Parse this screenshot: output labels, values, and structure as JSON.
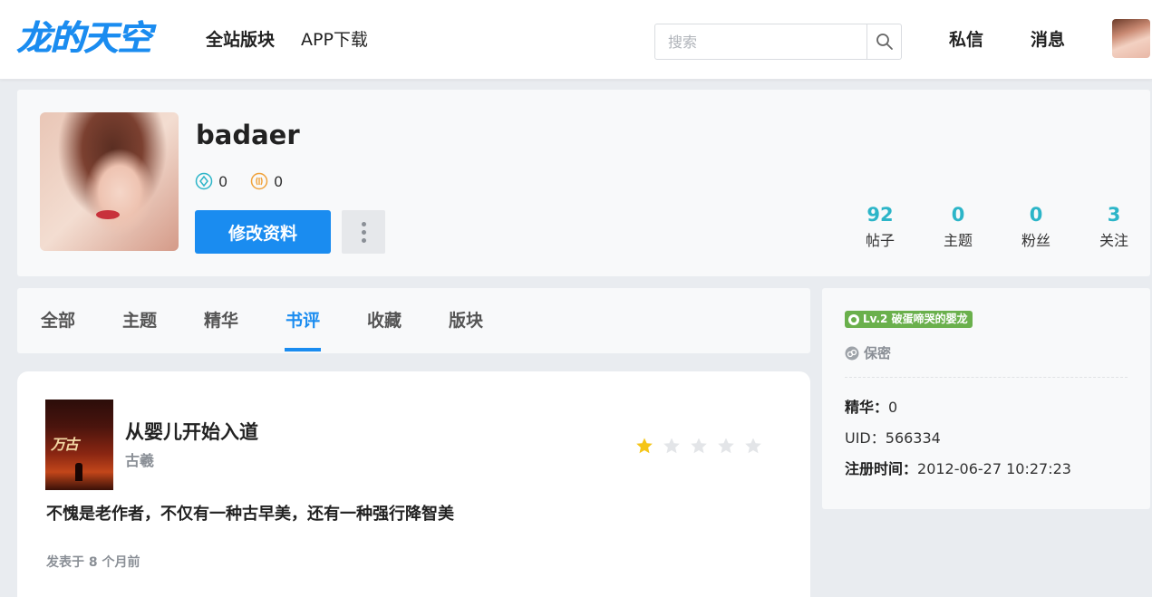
{
  "header": {
    "logo": "龙的天空",
    "nav": [
      "全站版块",
      "APP下载"
    ],
    "search_placeholder": "搜索",
    "messages_label": "私信",
    "notifications_label": "消息"
  },
  "profile": {
    "username": "badaer",
    "diamond_count": "0",
    "coin_count": "0",
    "edit_button": "修改资料",
    "stats": [
      {
        "value": "92",
        "label": "帖子"
      },
      {
        "value": "0",
        "label": "主题"
      },
      {
        "value": "0",
        "label": "粉丝"
      },
      {
        "value": "3",
        "label": "关注"
      }
    ]
  },
  "tabs": [
    "全部",
    "主题",
    "精华",
    "书评",
    "收藏",
    "版块"
  ],
  "active_tab": "书评",
  "review": {
    "book_title": "从婴儿开始入道",
    "author": "古羲",
    "rating": 1,
    "rating_max": 5,
    "text": "不愧是老作者，不仅有一种古早美，还有一种强行降智美",
    "meta": "发表于 8 个月前"
  },
  "sidebar": {
    "level_badge": "Lv.2 破蛋啼哭的婴龙",
    "gender": "保密",
    "jinghua_label": "精华：",
    "jinghua_value": "0",
    "uid_label": "UID：",
    "uid_value": "566334",
    "reg_label": "注册时间：",
    "reg_value": "2012-06-27 10:27:23"
  },
  "colors": {
    "accent": "#1a8cf0",
    "stat_number": "#2cb5c8",
    "level_green": "#6ab04c",
    "star_filled": "#f5c518",
    "star_empty": "#e3e5e8"
  }
}
